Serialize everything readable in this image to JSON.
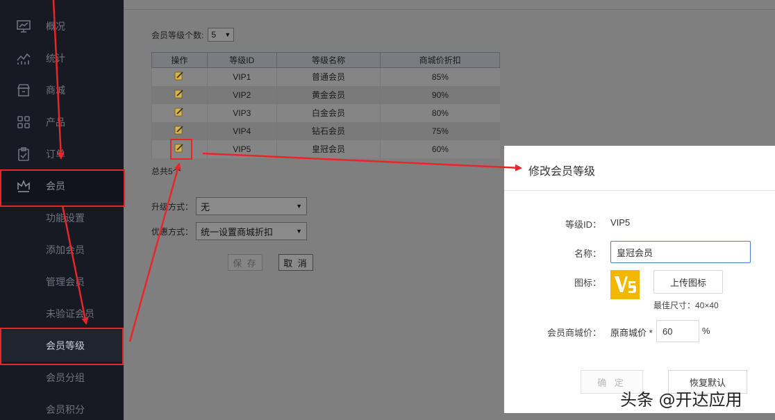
{
  "sidebar": {
    "items": [
      {
        "label": "概况",
        "icon": "presentation-icon"
      },
      {
        "label": "统计",
        "icon": "chart-icon"
      },
      {
        "label": "商城",
        "icon": "store-icon"
      },
      {
        "label": "产品",
        "icon": "grid-icon"
      },
      {
        "label": "订单",
        "icon": "clipboard-icon"
      },
      {
        "label": "会员",
        "icon": "crown-icon"
      }
    ],
    "sub_items": [
      {
        "label": "功能设置"
      },
      {
        "label": "添加会员"
      },
      {
        "label": "管理会员"
      },
      {
        "label": "未验证会员"
      },
      {
        "label": "会员等级"
      },
      {
        "label": "会员分组"
      },
      {
        "label": "会员积分"
      }
    ]
  },
  "main": {
    "count_label": "会员等级个数:",
    "count_value": "5",
    "table": {
      "headers": [
        "操作",
        "等级ID",
        "等级名称",
        "商城价折扣"
      ],
      "rows": [
        {
          "id": "VIP1",
          "name": "普通会员",
          "discount": "85%"
        },
        {
          "id": "VIP2",
          "name": "黄金会员",
          "discount": "90%"
        },
        {
          "id": "VIP3",
          "name": "白金会员",
          "discount": "80%"
        },
        {
          "id": "VIP4",
          "name": "钻石会员",
          "discount": "75%"
        },
        {
          "id": "VIP5",
          "name": "皇冠会员",
          "discount": "60%"
        }
      ]
    },
    "total": "总共5个",
    "upgrade_label": "升级方式：",
    "upgrade_value": "无",
    "discount_label": "优惠方式：",
    "discount_value": "统一设置商城折扣",
    "save_label": "保 存",
    "cancel_label": "取 消"
  },
  "modal": {
    "title": "修改会员等级",
    "level_id_label": "等级ID：",
    "level_id_value": "VIP5",
    "name_label": "名称：",
    "name_value": "皇冠会员",
    "icon_label": "图标：",
    "upload_label": "上传图标",
    "size_hint": "最佳尺寸：40×40",
    "price_label": "会员商城价：",
    "price_prefix": "原商城价 *",
    "price_value": "60",
    "price_unit": "%",
    "confirm_label": "确 定",
    "restore_label": "恢复默认"
  },
  "watermark": "头条 @开达应用",
  "colors": {
    "highlight": "#e8262a",
    "logo": "#f2b705",
    "input_focus": "#3c7dd6"
  }
}
